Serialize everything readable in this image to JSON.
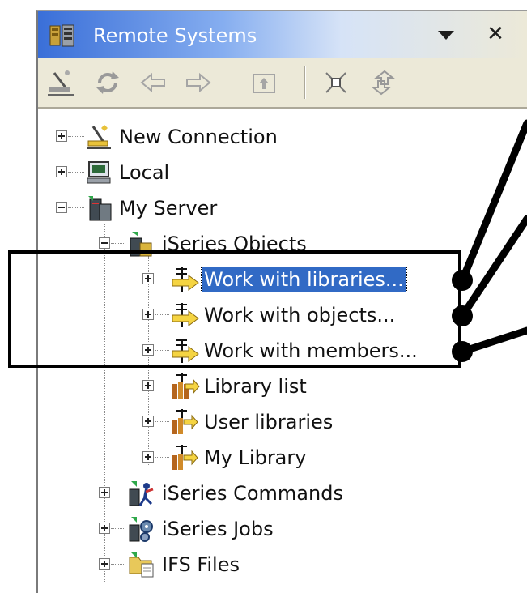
{
  "window": {
    "title": "Remote Systems",
    "title_icon": "remote-systems-icon",
    "menu_icon": "view-menu-dropdown-icon",
    "close_icon": "close-icon"
  },
  "toolbar": {
    "buttons": [
      {
        "name": "new-connection-button",
        "icon": "new-connection-icon"
      },
      {
        "name": "refresh-button",
        "icon": "refresh-icon"
      },
      {
        "name": "back-button",
        "icon": "back-arrow-icon"
      },
      {
        "name": "forward-button",
        "icon": "forward-arrow-icon"
      },
      {
        "name": "up-button",
        "icon": "up-folder-icon"
      },
      {
        "name": "collapse-all-button",
        "icon": "collapse-all-icon"
      },
      {
        "name": "link-with-editor-button",
        "icon": "link-icon"
      }
    ]
  },
  "tree": {
    "new_connection": "New Connection",
    "local": "Local",
    "my_server": "My Server",
    "iseries_objects": "iSeries Objects",
    "work_with_libraries": "Work with libraries...",
    "work_with_objects": "Work with objects...",
    "work_with_members": "Work with members...",
    "library_list": "Library list",
    "user_libraries": "User libraries",
    "my_library": "My Library",
    "iseries_commands": "iSeries Commands",
    "iseries_jobs": "iSeries Jobs",
    "ifs_files": "IFS Files",
    "selected": "Work with libraries..."
  },
  "colors": {
    "title_gradient_start": "#3a6fd8",
    "selection": "#316ac5",
    "toolbar_bg": "#ece9d8",
    "callout": "#000000"
  }
}
